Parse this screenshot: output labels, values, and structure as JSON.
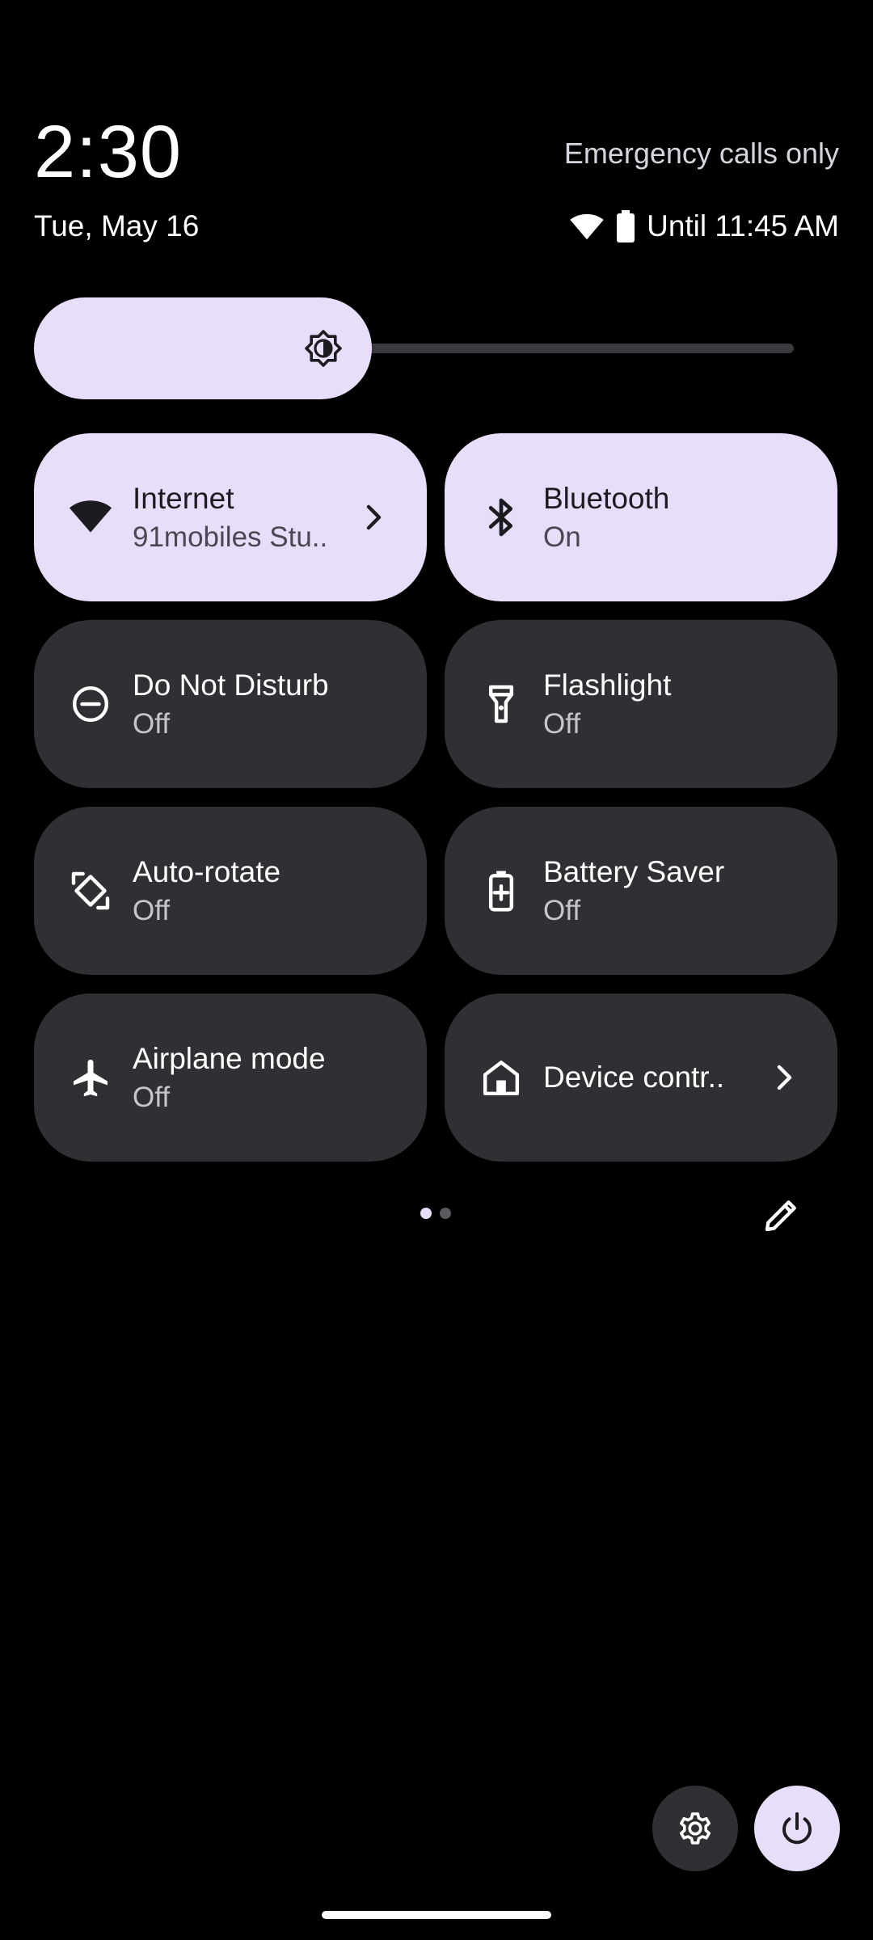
{
  "header": {
    "time": "2:30",
    "date": "Tue, May 16",
    "carrier": "Emergency calls only",
    "battery_text": "Until 11:45 AM",
    "icons": [
      "wifi-icon",
      "battery-icon"
    ]
  },
  "brightness": {
    "level": 0.445,
    "icon": "brightness-icon"
  },
  "tiles": [
    {
      "label": "Internet",
      "state": "91mobiles Stu..",
      "active": true,
      "icon": "wifi-icon",
      "chevron": true
    },
    {
      "label": "Bluetooth",
      "state": "On",
      "active": true,
      "icon": "bluetooth-icon",
      "chevron": false
    },
    {
      "label": "Do Not Disturb",
      "state": "Off",
      "active": false,
      "icon": "do-not-disturb-icon",
      "chevron": false
    },
    {
      "label": "Flashlight",
      "state": "Off",
      "active": false,
      "icon": "flashlight-icon",
      "chevron": false
    },
    {
      "label": "Auto-rotate",
      "state": "Off",
      "active": false,
      "icon": "auto-rotate-icon",
      "chevron": false
    },
    {
      "label": "Battery Saver",
      "state": "Off",
      "active": false,
      "icon": "battery-saver-icon",
      "chevron": false
    },
    {
      "label": "Airplane mode",
      "state": "Off",
      "active": false,
      "icon": "airplane-icon",
      "chevron": false
    },
    {
      "label": "Device contr..",
      "state": "",
      "active": false,
      "icon": "home-icon",
      "chevron": true
    }
  ],
  "pager": {
    "count": 2,
    "current": 1
  },
  "colors": {
    "accent": "#e8ddfb",
    "tile_inactive": "#303034",
    "background": "#000000"
  }
}
